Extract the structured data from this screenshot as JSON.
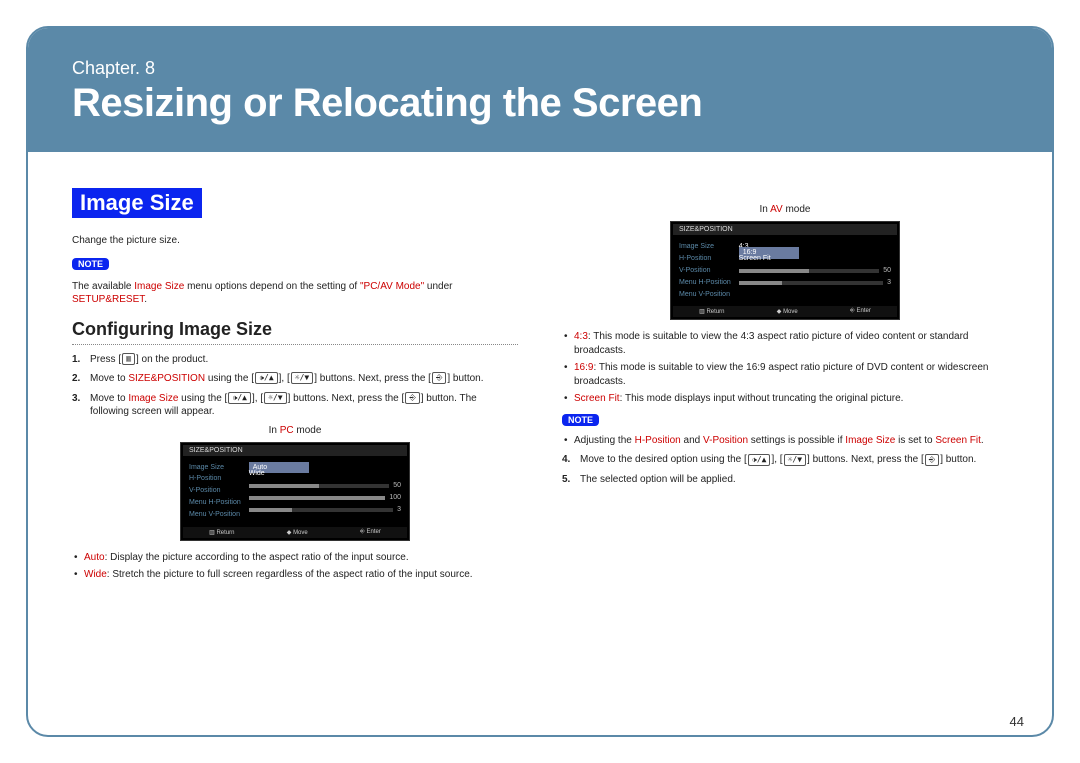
{
  "header": {
    "chapter": "Chapter. 8",
    "title": "Resizing or Relocating the Screen"
  },
  "pageNumber": "44",
  "left": {
    "sectionBadge": "Image Size",
    "intro": "Change the picture size.",
    "noteBadge": "NOTE",
    "noteText_pre": "The available ",
    "noteText_img": "Image Size",
    "noteText_mid": " menu options depend on the setting of ",
    "noteText_pcav": "\"PC/AV Mode\"",
    "noteText_under": " under ",
    "noteText_setup": "SETUP&RESET",
    "noteText_end": ".",
    "subtitle": "Configuring Image Size",
    "s1_a": "Press [",
    "s1_b": "] on the product.",
    "s2_a": "Move to ",
    "s2_b": "SIZE&POSITION",
    "s2_c": " using the [",
    "s2_d": "], [",
    "s2_e": "] buttons. Next, press the [",
    "s2_f": "] button.",
    "s3_a": "Move to ",
    "s3_b": "Image Size",
    "s3_c": " using the [",
    "s3_d": "], [",
    "s3_e": "] buttons. Next, press the [",
    "s3_f": "] button. The following screen will appear.",
    "pcMode_pre": "In ",
    "pcMode_hi": "PC",
    "pcMode_post": " mode",
    "bullet_auto_k": "Auto",
    "bullet_auto_t": ": Display the picture according to the aspect ratio of the input source.",
    "bullet_wide_k": "Wide",
    "bullet_wide_t": ": Stretch the picture to full screen regardless of the aspect ratio of the input source."
  },
  "right": {
    "avMode_pre": "In ",
    "avMode_hi": "AV",
    "avMode_post": " mode",
    "b43_k": "4:3",
    "b43_t": ": This mode is suitable to view the 4:3 aspect ratio picture of video content or standard broadcasts.",
    "b169_k": "16:9",
    "b169_t": ": This mode is suitable to view the 16:9 aspect ratio picture of DVD content or widescreen broadcasts.",
    "bsf_k": "Screen Fit",
    "bsf_t": ": This mode displays input without truncating the original picture.",
    "noteBadge": "NOTE",
    "note2_a": "Adjusting the ",
    "note2_b": "H-Position",
    "note2_c": " and ",
    "note2_d": "V-Position",
    "note2_e": " settings is possible if ",
    "note2_f": "Image Size",
    "note2_g": " is set to ",
    "note2_h": "Screen Fit",
    "note2_i": ".",
    "s4_a": "Move to the desired option using the [",
    "s4_b": "], [",
    "s4_c": "] buttons. Next, press the [",
    "s4_d": "] button.",
    "s5": "The selected option will be applied."
  },
  "osd": {
    "title": "SIZE&POSITION",
    "labels": [
      "Image Size",
      "H-Position",
      "V-Position",
      "Menu H-Position",
      "Menu V-Position"
    ],
    "pc_values": [
      "Auto",
      "Wide"
    ],
    "av_values": [
      "4:3",
      "16:9",
      "Screen Fit"
    ],
    "sliders": [
      {
        "val": "50",
        "pct": 50
      },
      {
        "val": "50",
        "pct": 50
      },
      {
        "val": "100",
        "pct": 100
      },
      {
        "val": "3",
        "pct": 30
      }
    ],
    "foot": [
      "▥ Return",
      "◆ Move",
      "⎆ Enter"
    ]
  }
}
